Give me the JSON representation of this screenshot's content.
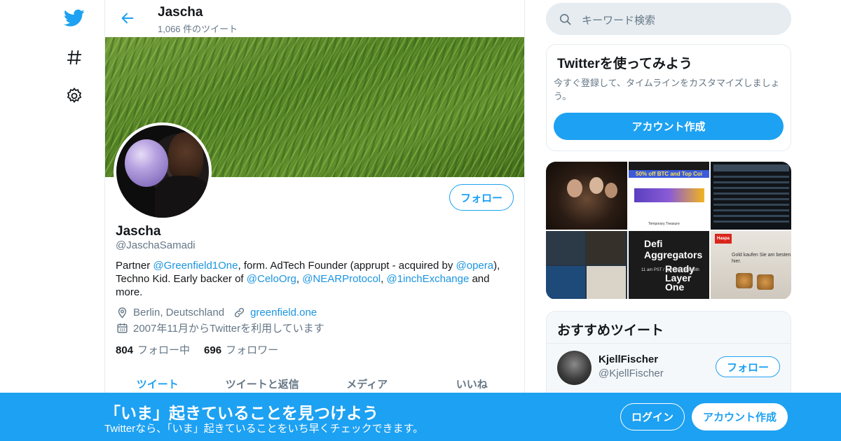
{
  "colors": {
    "accent": "#1da1f2",
    "link": "#1b95e0",
    "secondary_text": "#657786",
    "border": "#e6ecf0"
  },
  "nav": {
    "icons": [
      "twitter-bird-icon",
      "hashtag-icon",
      "gear-icon"
    ]
  },
  "header": {
    "name": "Jascha",
    "tweet_count": "1,066 件のツイート"
  },
  "profile": {
    "follow_label": "フォロー",
    "name": "Jascha",
    "handle": "@JaschaSamadi",
    "bio": {
      "t1": "Partner ",
      "m1": "@Greenfield1One",
      "t2": ", form. AdTech Founder (apprupt - acquired by ",
      "m2": "@opera",
      "t3": "), Techno Kid. Early backer of ",
      "m3": "@CeloOrg",
      "t4": ", ",
      "m4": "@NEARProtocol",
      "t5": ", ",
      "m5": "@1inchExchange",
      "t6": " and more."
    },
    "location": "Berlin, Deutschland",
    "website": "greenfield.one",
    "joined": "2007年11月からTwitterを利用しています",
    "following_count": "804",
    "following_label": "フォロー中",
    "followers_count": "696",
    "followers_label": "フォロワー"
  },
  "tabs": [
    "ツイート",
    "ツイートと返信",
    "メディア",
    "いいね"
  ],
  "search": {
    "placeholder": "キーワード検索"
  },
  "signup_card": {
    "title": "Twitterを使ってみよう",
    "description": "今すぐ登録して、タイムラインをカスタマイズしましょう。",
    "button": "アカウント作成"
  },
  "media": {
    "promo_text": "50% off BTC and Top Coi",
    "ad_caption": "Temporary Treasure",
    "defi_title": "Defi Aggregators",
    "defi_sub": "Ready Layer One",
    "defi_time": "11 am PST / 8pm CET May 5th",
    "bank_label": "Haspa",
    "gold_text": "Gold kaufen Sie am besten hier."
  },
  "recommended": {
    "title": "おすすめツイート",
    "name": "KjellFischer",
    "handle": "@KjellFischer",
    "follow_label": "フォロー"
  },
  "bottom_banner": {
    "title": "「いま」起きていることを見つけよう",
    "subtitle": "Twitterなら、「いま」起きていることをいち早くチェックできます。",
    "login": "ログイン",
    "signup": "アカウント作成"
  }
}
